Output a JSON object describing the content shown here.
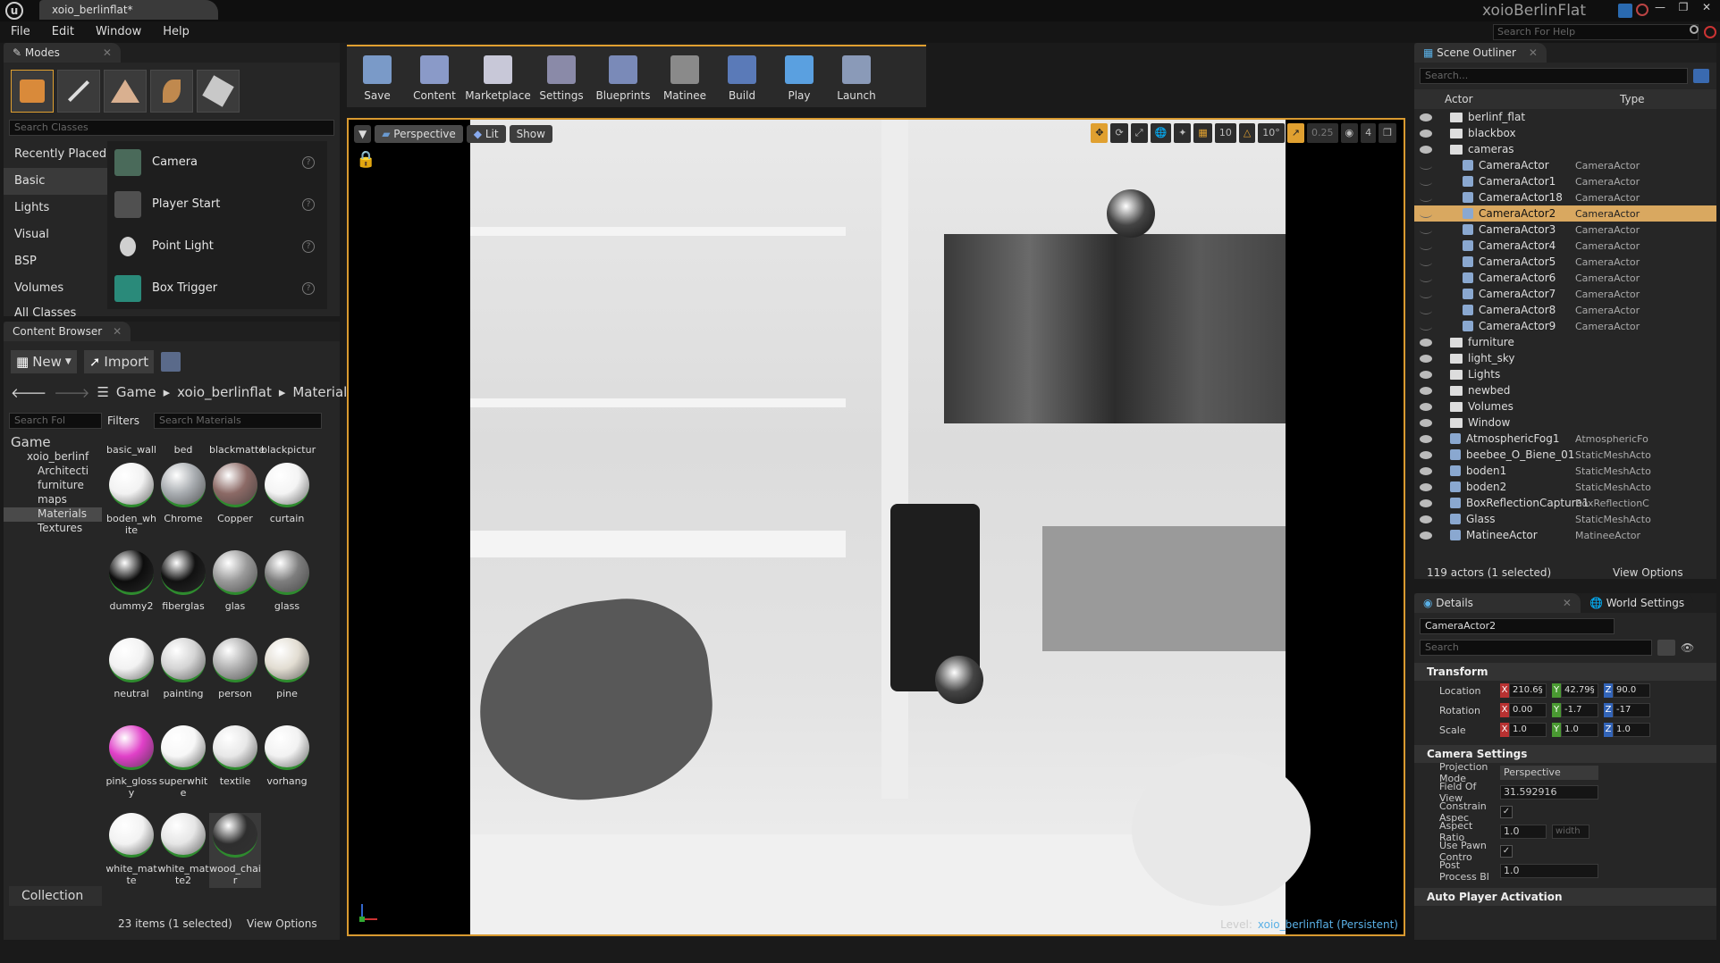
{
  "window": {
    "tab_title": "xoio_berlinflat*",
    "project_name": "xoioBerlinFlat",
    "help_search_placeholder": "Search For Help"
  },
  "menu": [
    "File",
    "Edit",
    "Window",
    "Help"
  ],
  "modes": {
    "tab": "Modes",
    "search_placeholder": "Search Classes",
    "categories": [
      "Recently Placed",
      "Basic",
      "Lights",
      "Visual",
      "BSP",
      "Volumes",
      "All Classes"
    ],
    "items": [
      "Camera",
      "Player Start",
      "Point Light",
      "Box Trigger"
    ]
  },
  "content_browser": {
    "tab": "Content Browser",
    "new_label": "New",
    "import_label": "Import",
    "path": [
      "Game",
      "xoio_berlinflat",
      "Materials"
    ],
    "folder_search_placeholder": "Search Fol",
    "filters_label": "Filters",
    "search_placeholder": "Search Materials",
    "tree": [
      "Game",
      "xoio_berlinf",
      "Architecti",
      "furniture",
      "maps",
      "Materials",
      "Textures"
    ],
    "materials_top_row": [
      "basic_wall",
      "bed",
      "blackmatte",
      "blackpictur"
    ],
    "materials": [
      {
        "name": "boden_white",
        "color": "#f2f2f2"
      },
      {
        "name": "Chrome",
        "color": "#a8acb0"
      },
      {
        "name": "Copper",
        "color": "#8c6a66"
      },
      {
        "name": "curtain",
        "color": "#f4f4f4"
      },
      {
        "name": "dummy2",
        "color": "#0d0d0d"
      },
      {
        "name": "fiberglas",
        "color": "#111111"
      },
      {
        "name": "glas",
        "color": "#9a9a9a"
      },
      {
        "name": "glass",
        "color": "#7e7e7e"
      },
      {
        "name": "neutral",
        "color": "#f2f2f2"
      },
      {
        "name": "painting",
        "color": "#d4d4d4"
      },
      {
        "name": "person",
        "color": "#b0b0b0"
      },
      {
        "name": "pine",
        "color": "#e2ddd2"
      },
      {
        "name": "pink_glossy",
        "color": "#e040c8"
      },
      {
        "name": "superwhite",
        "color": "#f7f7f7"
      },
      {
        "name": "textile",
        "color": "#e8e8e8"
      },
      {
        "name": "vorhang",
        "color": "#f2f2f2"
      },
      {
        "name": "white_matte",
        "color": "#f2f2f2"
      },
      {
        "name": "white_matte2",
        "color": "#e6e6e6"
      },
      {
        "name": "wood_chair",
        "color": "#2e2e2e"
      }
    ],
    "status": "23 items (1 selected)",
    "view_options": "View Options",
    "collections": "Collection"
  },
  "toolbar": [
    "Save",
    "Content",
    "Marketplace",
    "Settings",
    "Blueprints",
    "Matinee",
    "Build",
    "Play",
    "Launch"
  ],
  "viewport": {
    "perspective": "Perspective",
    "lit": "Lit",
    "show": "Show",
    "grid_snap": "10",
    "rot_snap": "10°",
    "scale_snap": "0.25",
    "cam_speed": "4",
    "level_label": "Level:",
    "level_name": "xoio_berlinflat (Persistent)"
  },
  "outliner": {
    "tab": "Scene Outliner",
    "search_placeholder": "Search...",
    "col_actor": "Actor",
    "col_type": "Type",
    "rows": [
      {
        "name": "berlinf_flat",
        "type": "",
        "folder": true,
        "indent": 0
      },
      {
        "name": "blackbox",
        "type": "",
        "folder": true,
        "indent": 0
      },
      {
        "name": "cameras",
        "type": "",
        "folder": true,
        "indent": 0
      },
      {
        "name": "CameraActor",
        "type": "CameraActor",
        "folder": false,
        "indent": 1
      },
      {
        "name": "CameraActor1",
        "type": "CameraActor",
        "folder": false,
        "indent": 1
      },
      {
        "name": "CameraActor18",
        "type": "CameraActor",
        "folder": false,
        "indent": 1
      },
      {
        "name": "CameraActor2",
        "type": "CameraActor",
        "folder": false,
        "indent": 1,
        "selected": true
      },
      {
        "name": "CameraActor3",
        "type": "CameraActor",
        "folder": false,
        "indent": 1
      },
      {
        "name": "CameraActor4",
        "type": "CameraActor",
        "folder": false,
        "indent": 1
      },
      {
        "name": "CameraActor5",
        "type": "CameraActor",
        "folder": false,
        "indent": 1
      },
      {
        "name": "CameraActor6",
        "type": "CameraActor",
        "folder": false,
        "indent": 1
      },
      {
        "name": "CameraActor7",
        "type": "CameraActor",
        "folder": false,
        "indent": 1
      },
      {
        "name": "CameraActor8",
        "type": "CameraActor",
        "folder": false,
        "indent": 1
      },
      {
        "name": "CameraActor9",
        "type": "CameraActor",
        "folder": false,
        "indent": 1
      },
      {
        "name": "furniture",
        "type": "",
        "folder": true,
        "indent": 0
      },
      {
        "name": "light_sky",
        "type": "",
        "folder": true,
        "indent": 0
      },
      {
        "name": "Lights",
        "type": "",
        "folder": true,
        "indent": 0
      },
      {
        "name": "newbed",
        "type": "",
        "folder": true,
        "indent": 0
      },
      {
        "name": "Volumes",
        "type": "",
        "folder": true,
        "indent": 0
      },
      {
        "name": "Window",
        "type": "",
        "folder": true,
        "indent": 0
      },
      {
        "name": "AtmosphericFog1",
        "type": "AtmosphericFo",
        "folder": false,
        "indent": 0
      },
      {
        "name": "beebee_O_Biene_01",
        "type": "StaticMeshActo",
        "folder": false,
        "indent": 0
      },
      {
        "name": "boden1",
        "type": "StaticMeshActo",
        "folder": false,
        "indent": 0
      },
      {
        "name": "boden2",
        "type": "StaticMeshActo",
        "folder": false,
        "indent": 0
      },
      {
        "name": "BoxReflectionCapture1",
        "type": "BoxReflectionC",
        "folder": false,
        "indent": 0
      },
      {
        "name": "Glass",
        "type": "StaticMeshActo",
        "folder": false,
        "indent": 0
      },
      {
        "name": "MatineeActor",
        "type": "MatineeActor",
        "folder": false,
        "indent": 0
      }
    ],
    "status": "119 actors (1 selected)",
    "view_options": "View Options"
  },
  "details": {
    "tab": "Details",
    "world_tab": "World Settings",
    "actor_name": "CameraActor2",
    "search_placeholder": "Search",
    "transform_title": "Transform",
    "location_label": "Location",
    "rotation_label": "Rotation",
    "scale_label": "Scale",
    "location": [
      "210.6§",
      "42.79§",
      "90.0"
    ],
    "rotation": [
      "0.00",
      "-1.7",
      "-17"
    ],
    "scale": [
      "1.0",
      "1.0",
      "1.0"
    ],
    "camera_title": "Camera Settings",
    "projection_label": "Projection Mode",
    "projection_value": "Perspective",
    "fov_label": "Field Of View",
    "fov_value": "31.592916",
    "constrain_label": "Constrain Aspec",
    "aspect_label": "Aspect Ratio",
    "aspect_value": "1.0",
    "aspect_width": "width",
    "pawn_label": "Use Pawn Contro",
    "postprocess_label": "Post Process Bl",
    "postprocess_value": "1.0",
    "auto_player_title": "Auto Player Activation"
  }
}
